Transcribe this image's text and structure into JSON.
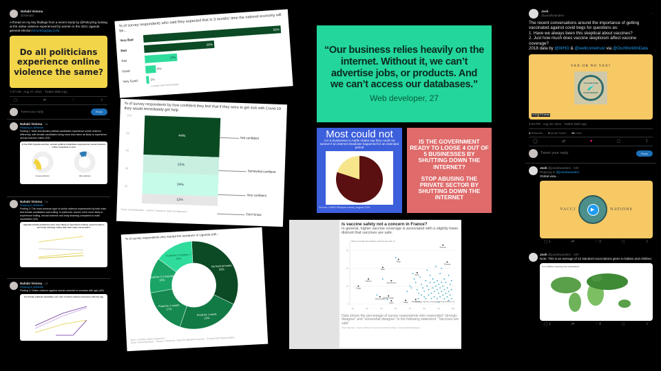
{
  "left_thread": {
    "author": "Nahabi Visiona",
    "handle": "@Nahabi",
    "tweet1": {
      "text": "A thread on my key findings from a recent study by @PolicyOrg looking at the online violence experienced by women in the 2021 Uganda general election",
      "link": "bit.ly/3OgQtpq (1/5)",
      "image_text": "Do all politicians experience online violence the same?",
      "meta": "7:37 AM · Aug 27, 2021 · Twitter Web App",
      "reply_placeholder": "Tweet your reply",
      "reply_button": "Reply"
    },
    "replying_to": "Replying to @Nahabi",
    "tweet2": {
      "time": "· 11h",
      "text": "Finding 1: Male and female political candidates experience online violence differently, with female candidates being more than twice as likely to experience sexual violence online (2/5)",
      "image_title": "In the 2021 Uganda election, women political candidates experienced sexual violence online compared to men",
      "labels": [
        "Female politicians",
        "Male politicians"
      ],
      "colors": {
        "female": "#f1d33b",
        "male": "#2f7bb5"
      }
    },
    "tweet3": {
      "time": "· 11h",
      "text": "Finding 2: The most common type of online violence experienced by both male and female candidates was trolling. In particular, women were more likely to experience trolling, sexual violence and body shaming compared to male candidates (3/5)",
      "image_title": "Ugandan female politicians were more likely to experience trolling, sexual violence and body shaming online than their male counterparts"
    },
    "tweet4": {
      "time": "· 11h",
      "text": "Finding 3: Online violence against women seemed to increase with age (4/5)",
      "image_title": "For female political candidates, the risk of online violence increases with the age"
    }
  },
  "bar_card": {
    "footer": "Created with Datawrapper"
  },
  "stacked_card": {
    "footer": "Chart: Ismail Bardanu · Source: Twaweza: Sauti Za Wananchi"
  },
  "donut_card": {
    "note": "Note: excludes blank responses",
    "footer": "Chart: Ismail Bardanu · Source: Twaweza: Sauti Za Wananchi survey · Created with Datawrapper"
  },
  "quote_card": {
    "quote": "“Our business relies heavily on the internet. Without it, we can’t advertise jobs, or products. And we can’t access our databases.”",
    "attribution": "Web developer, 27",
    "color": "#22d69c"
  },
  "blue_card": {
    "title": "Most could not",
    "subtitle": "4 in 5 businesses in Addis Ababa say they could not survive if an internet shutdown happened for an extended period",
    "source": "Source: CARD Ethiopia survey, August 2021",
    "color": "#3c5fdc"
  },
  "red_card": {
    "q": "IS THE GOVERNMENT READY TO LOOSE 4 OUT OF 5 BUSINESSES BY SHUTTING DOWN THE INTERNET?",
    "cta": "STOP ABUSING THE PRIVATE SECTOR BY SHUTTING DOWN THE INTERNET",
    "color": "#df6b6b"
  },
  "scatter_card": {
    "subtitle": "In general, higher vaccine coverage is associated with a slightly lower distrust that vaccines are safe.",
    "y_note": "Share of people who disagree vaccines are safe, %",
    "x_note": "Average vaccine coverage among children, %",
    "footer": "Data shows the percentage of survey respondents who responded \"strongly disagree\" and \"somewhat disagree\" to the following statement: \"Vaccines are safe\"",
    "credit": "Chart: Wanders · Source: Wellcome Trust via Our World in Data · Created with Datawrapper"
  },
  "right_thread": {
    "author": "Josh",
    "handle": "@josiahwanders",
    "tweet1": {
      "text": "The recent conversations around the importance of getting vaccinated against covid begs for questions as:\n1. Have we always been this skeptical about vaccines?\n2. Just how much does vaccine skepticism affect vaccine coverage?\n2018 data by ",
      "m1": "@WHO",
      "amp": " & ",
      "m2": "@wellcometrust",
      "via": " via ",
      "m3": "@OurWorldInData",
      "video_title": "VAX OR NO VAX?",
      "logo_top": "TO EVERYONE",
      "logo_bottom": "EVERYWHERE",
      "duration": "0:00",
      "views": "278 views",
      "meta": "3:34 PM · Aug 28, 2021 · Twitter Web App",
      "retweets": "4",
      "retweets_label": "Retweets",
      "quotes": "1",
      "quotes_label": "Quote Tweet",
      "likes": "10",
      "likes_label": "Likes",
      "reply_placeholder": "Tweet your reply",
      "reply_button": "Reply"
    },
    "tweet2": {
      "time": "· 22h",
      "replying": "Replying to ",
      "replying_handle": "@josiahwanders",
      "text": "Global view...",
      "video_left": "VACCI",
      "video_right": "NATIONS",
      "replies": "1",
      "likes": "3"
    },
    "tweet3": {
      "time": "· 22h",
      "text": "Note: This is an average of 12 standard vaccinations given to babies and children.",
      "map_title": "% of children receiving core vaccinations",
      "replies": "1",
      "likes": "4"
    }
  },
  "chart_data": [
    {
      "type": "bar",
      "title": "% of survey respondents who said they expected that in 3 months' time the national economy will be...",
      "categories": [
        "Very Bad",
        "Bad",
        "Fair",
        "Good",
        "Very Good"
      ],
      "values": [
        55,
        28,
        13,
        4,
        1
      ],
      "value_suffix": "%",
      "colors": [
        "#0b4a24",
        "#0b4a24",
        "#2fdc9c",
        "#2fdc9c",
        "#2fdc9c"
      ]
    },
    {
      "type": "bar",
      "stacked": true,
      "title": "% of survey respondents by how confident they feel that if they were to get sick with Covid-19 they would immediately get help",
      "categories": [
        "Not confident",
        "Somewhat confident",
        "Very confident",
        "Don't know"
      ],
      "values": [
        44,
        21,
        24,
        11
      ],
      "value_suffix": "%",
      "yticks": [
        100,
        80,
        60,
        40,
        20
      ],
      "ylim": [
        0,
        100
      ],
      "colors": [
        "#0a4a22",
        "#c8efe0",
        "#c6fbe9",
        "#e6e6e6"
      ]
    },
    {
      "type": "pie",
      "donut": true,
      "title": "% of survey respondents who started the lockdown in Uganda with...",
      "categories": [
        "No food at home",
        "Food for 1 week",
        "Food for 1 month",
        "Food for 1-3 months",
        "Food for 3 months +"
      ],
      "values": [
        33,
        23,
        17,
        13,
        14
      ],
      "value_suffix": "%",
      "colors": [
        "#0b4a24",
        "#117a45",
        "#15894f",
        "#1aa566",
        "#2fdc9c"
      ]
    },
    {
      "type": "pie",
      "title": "",
      "values": [
        80,
        20
      ],
      "colors": [
        "#5a0f10",
        "#f6e58b"
      ]
    },
    {
      "type": "scatter",
      "title": "Is vaccine safety not a concern in France?",
      "xlim": [
        28,
        102
      ],
      "ylim": [
        -1,
        36
      ],
      "xticks": [
        30,
        40,
        50,
        60,
        70,
        80,
        90,
        100
      ],
      "yticks": [
        0,
        10,
        20,
        30
      ],
      "labeled_points": [
        {
          "label": "France",
          "x": 93,
          "y": 33
        },
        {
          "label": "Russia",
          "x": 96,
          "y": 23.5
        },
        {
          "label": "Togo",
          "x": 62,
          "y": 25
        },
        {
          "label": "Haiti",
          "x": 51,
          "y": 20.5
        },
        {
          "label": "Cameroon",
          "x": 57,
          "y": 13
        },
        {
          "label": "Peru",
          "x": 75,
          "y": 17.5
        },
        {
          "label": "Gabon",
          "x": 41,
          "y": 14
        },
        {
          "label": "Chad",
          "x": 34,
          "y": 10
        },
        {
          "label": "Afghanistan",
          "x": 55,
          "y": 4.5
        },
        {
          "label": "Venezuela",
          "x": 49,
          "y": 4
        },
        {
          "label": "Laos",
          "x": 57,
          "y": 1.8
        },
        {
          "label": "India",
          "x": 67,
          "y": 2
        },
        {
          "label": "Tanzania",
          "x": 74,
          "y": 2.5
        }
      ],
      "points": [
        [
          60,
          26
        ],
        [
          51,
          14
        ],
        [
          47,
          5
        ],
        [
          54,
          2.5
        ],
        [
          68,
          7
        ],
        [
          70,
          10
        ],
        [
          71,
          9
        ],
        [
          72,
          17
        ],
        [
          73,
          14
        ],
        [
          74,
          12
        ],
        [
          75,
          8
        ],
        [
          76,
          6
        ],
        [
          76,
          3
        ],
        [
          77,
          15
        ],
        [
          78,
          11
        ],
        [
          78,
          5
        ],
        [
          79,
          9
        ],
        [
          80,
          7
        ],
        [
          80,
          4
        ],
        [
          81,
          13
        ],
        [
          81,
          3
        ],
        [
          82,
          19
        ],
        [
          82,
          10
        ],
        [
          83,
          8
        ],
        [
          83,
          5
        ],
        [
          84,
          16
        ],
        [
          84,
          12
        ],
        [
          85,
          6
        ],
        [
          85,
          3
        ],
        [
          86,
          14
        ],
        [
          86,
          9
        ],
        [
          87,
          12
        ],
        [
          87,
          7
        ],
        [
          87,
          4
        ],
        [
          88,
          21
        ],
        [
          88,
          10
        ],
        [
          89,
          13
        ],
        [
          89,
          8
        ],
        [
          89,
          3
        ],
        [
          90,
          11
        ],
        [
          90,
          6
        ],
        [
          90,
          1
        ],
        [
          91,
          17
        ],
        [
          91,
          9
        ],
        [
          91,
          4
        ],
        [
          92,
          20
        ],
        [
          92,
          12
        ],
        [
          92,
          7
        ],
        [
          93,
          10
        ],
        [
          93,
          5
        ],
        [
          94,
          14
        ],
        [
          94,
          8
        ],
        [
          94,
          3
        ],
        [
          95,
          12
        ],
        [
          95,
          6
        ],
        [
          96,
          9
        ],
        [
          96,
          4
        ],
        [
          97,
          16
        ],
        [
          97,
          7
        ],
        [
          97,
          2
        ],
        [
          98,
          11
        ],
        [
          98,
          5
        ],
        [
          99,
          13
        ],
        [
          99,
          8
        ],
        [
          99,
          3
        ]
      ],
      "point_color": "#35a7c6"
    }
  ]
}
